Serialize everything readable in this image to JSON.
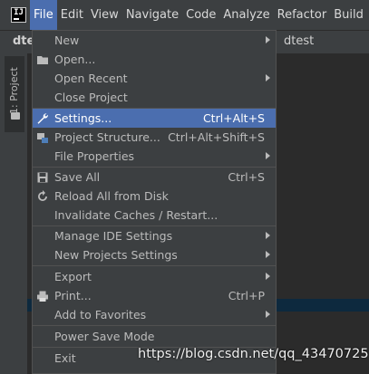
{
  "menubar": {
    "items": [
      "File",
      "Edit",
      "View",
      "Navigate",
      "Code",
      "Analyze",
      "Refactor",
      "Build"
    ]
  },
  "background": {
    "project_name_partial": "dte",
    "editor_tab_partial": "dtest",
    "tool_window_label": "1: Project"
  },
  "file_menu": {
    "items": [
      {
        "label": "New",
        "shortcut": "",
        "submenu": true,
        "icon": ""
      },
      {
        "label": "Open...",
        "shortcut": "",
        "submenu": false,
        "icon": "folder-icon"
      },
      {
        "label": "Open Recent",
        "shortcut": "",
        "submenu": true,
        "icon": ""
      },
      {
        "label": "Close Project",
        "shortcut": "",
        "submenu": false,
        "icon": ""
      },
      {
        "label": "Settings...",
        "shortcut": "Ctrl+Alt+S",
        "submenu": false,
        "icon": "wrench-icon",
        "selected": true
      },
      {
        "label": "Project Structure...",
        "shortcut": "Ctrl+Alt+Shift+S",
        "submenu": false,
        "icon": "project-structure-icon"
      },
      {
        "label": "File Properties",
        "shortcut": "",
        "submenu": true,
        "icon": ""
      },
      {
        "label": "Save All",
        "shortcut": "Ctrl+S",
        "submenu": false,
        "icon": "save-icon"
      },
      {
        "label": "Reload All from Disk",
        "shortcut": "",
        "submenu": false,
        "icon": "reload-icon"
      },
      {
        "label": "Invalidate Caches / Restart...",
        "shortcut": "",
        "submenu": false,
        "icon": ""
      },
      {
        "label": "Manage IDE Settings",
        "shortcut": "",
        "submenu": true,
        "icon": ""
      },
      {
        "label": "New Projects Settings",
        "shortcut": "",
        "submenu": true,
        "icon": ""
      },
      {
        "label": "Export",
        "shortcut": "",
        "submenu": true,
        "icon": ""
      },
      {
        "label": "Print...",
        "shortcut": "Ctrl+P",
        "submenu": false,
        "icon": "print-icon"
      },
      {
        "label": "Add to Favorites",
        "shortcut": "",
        "submenu": true,
        "icon": ""
      },
      {
        "label": "Power Save Mode",
        "shortcut": "",
        "submenu": false,
        "icon": ""
      },
      {
        "label": "Exit",
        "shortcut": "",
        "submenu": false,
        "icon": ""
      }
    ]
  },
  "watermark": "https://blog.csdn.net/qq_43470725",
  "colors": {
    "menubar_bg": "#3c3f41",
    "selection": "#4b6eaf",
    "text": "#bbbbbb"
  }
}
